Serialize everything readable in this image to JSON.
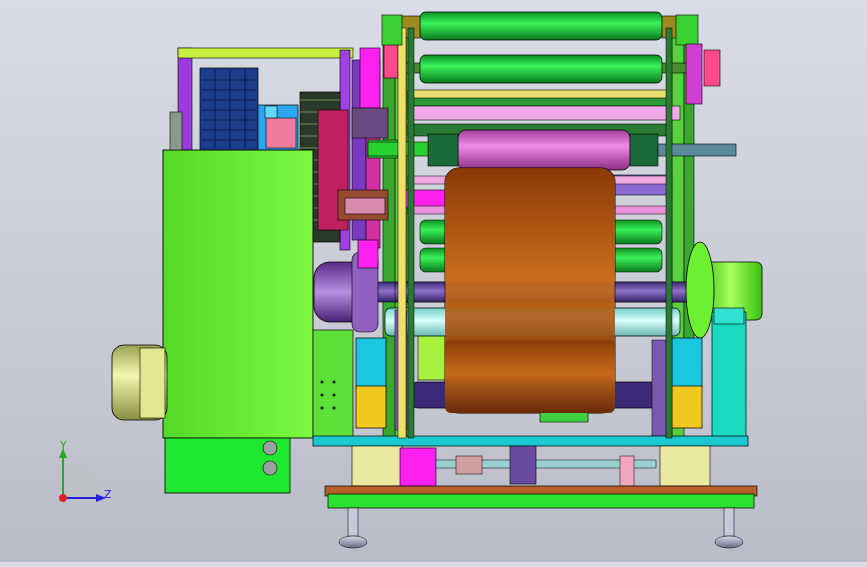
{
  "viewport": {
    "background_top": "#d9dce4",
    "background_bottom": "#b9bcc6"
  },
  "triad": {
    "y_label": "Y",
    "z_label": "Z",
    "y_color": "#22aa22",
    "z_color": "#2222dd",
    "x_color": "#dd2222"
  },
  "palette": {
    "main_frame": "#6cf233",
    "roller_green": "#22e03a",
    "roller_cyan": "#aef4f0",
    "drum_brown": "#c06a1c",
    "shaft_violet": "#7a5ab0",
    "magenta": "#ff22ee",
    "pink": "#e57ae0",
    "motor_yellow": "#e7ef98",
    "cyan_block": "#19d9d0",
    "gold": "#f0c820",
    "navy_gear": "#1c3c8c",
    "base_brown": "#7a4030",
    "frame_purple": "#8a2fd0"
  }
}
